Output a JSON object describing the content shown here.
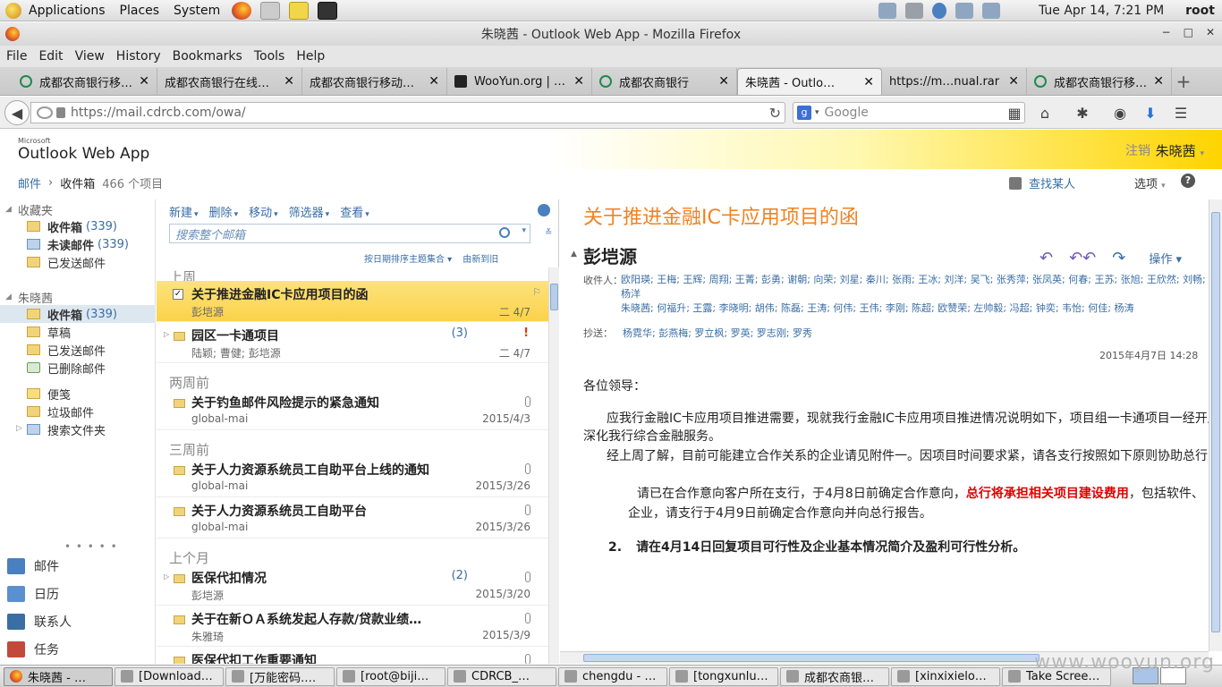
{
  "top_panel": {
    "menus": [
      "Applications",
      "Places",
      "System"
    ],
    "clock": "Tue Apr 14,  7:21 PM",
    "user": "root"
  },
  "window": {
    "title": "朱晓茜 - Outlook Web App - Mozilla Firefox",
    "controls": [
      "−",
      "□",
      "✕"
    ]
  },
  "menubar": [
    "File",
    "Edit",
    "View",
    "History",
    "Bookmarks",
    "Tools",
    "Help"
  ],
  "tabs": [
    {
      "label": "成都农商银行移…",
      "favicon": "cdrcb",
      "active": false
    },
    {
      "label": "成都农商银行在线…",
      "favicon": "none",
      "active": false
    },
    {
      "label": "成都农商银行移动…",
      "favicon": "none",
      "active": false
    },
    {
      "label": "WooYun.org | …",
      "favicon": "wooyun",
      "active": false
    },
    {
      "label": "成都农商银行",
      "favicon": "cdrcb",
      "active": false
    },
    {
      "label": "朱晓茜 - Outlo…",
      "favicon": "owa",
      "active": true
    },
    {
      "label": "https://m…nual.rar",
      "favicon": "none",
      "active": false
    },
    {
      "label": "成都农商银行移…",
      "favicon": "cdrcb",
      "active": false
    }
  ],
  "navbar": {
    "url_host": "https://mail.cdrcb.com",
    "url_path": "/owa/",
    "search_placeholder": "Google"
  },
  "owa": {
    "logo_small": "Microsoft",
    "logo": "Outlook Web App",
    "signout": "注销",
    "user": "朱晓茜",
    "breadcrumb": {
      "mail": "邮件",
      "sep": "›",
      "folder": "收件箱",
      "count": "466 个项目"
    },
    "find_people": "查找某人",
    "options": "选项",
    "help": "?"
  },
  "folders": {
    "favorites_label": "收藏夹",
    "favorites": [
      {
        "name": "收件箱",
        "count": "339",
        "bold": true,
        "icon": "inbox"
      },
      {
        "name": "未读邮件",
        "count": "339",
        "bold": true,
        "icon": "search"
      },
      {
        "name": "已发送邮件",
        "count": "",
        "bold": false,
        "icon": "sent"
      }
    ],
    "mailbox_label": "朱晓茜",
    "mailbox": [
      {
        "name": "收件箱",
        "count": "339",
        "bold": true,
        "selected": true,
        "icon": "inbox"
      },
      {
        "name": "草稿",
        "count": "",
        "bold": false,
        "icon": "drafts"
      },
      {
        "name": "已发送邮件",
        "count": "",
        "bold": false,
        "icon": "sent"
      },
      {
        "name": "已删除邮件",
        "count": "",
        "bold": false,
        "icon": "trash"
      }
    ],
    "other": [
      {
        "name": "便笺",
        "icon": "note"
      },
      {
        "name": "垃圾邮件",
        "icon": "junk"
      },
      {
        "name": "搜索文件夹",
        "icon": "search"
      }
    ],
    "modules": [
      {
        "name": "邮件",
        "icon": "mail"
      },
      {
        "name": "日历",
        "icon": "calendar"
      },
      {
        "name": "联系人",
        "icon": "contacts"
      },
      {
        "name": "任务",
        "icon": "tasks"
      }
    ]
  },
  "list": {
    "toolbar": [
      "新建",
      "删除",
      "移动",
      "筛选器",
      "查看"
    ],
    "search_placeholder": "搜索整个邮箱",
    "sort": [
      "按日期排序主题集合",
      "由新到旧"
    ],
    "groups": [
      "上周",
      "两周前",
      "三周前",
      "上个月"
    ],
    "messages": [
      {
        "subject": "关于推进金融IC卡应用项目的函",
        "sender": "彭垲源",
        "date": "二 4/7",
        "selected": true,
        "count": "",
        "attach": false
      },
      {
        "subject": "园区一卡通项目",
        "sender": "陆颖; 曹健; 彭垲源",
        "date": "二 4/7",
        "selected": false,
        "count": "(3)",
        "attach": false,
        "important": true
      },
      {
        "subject": "关于钓鱼邮件风险提示的紧急通知",
        "sender": "global-mai",
        "date": "2015/4/3",
        "selected": false,
        "count": "",
        "attach": true
      },
      {
        "subject": "关于人力资源系统员工自助平台上线的通知",
        "sender": "global-mai",
        "date": "2015/3/26",
        "selected": false,
        "count": "",
        "attach": true
      },
      {
        "subject": "关于人力资源系统员工自助平台",
        "sender": "global-mai",
        "date": "2015/3/26",
        "selected": false,
        "count": "",
        "attach": true
      },
      {
        "subject": "医保代扣情况",
        "sender": "彭垲源",
        "date": "2015/3/20",
        "selected": false,
        "count": "(2)",
        "attach": true
      },
      {
        "subject": "关于在新ＯＡ系统发起人存款/贷款业绩…",
        "sender": "朱雅琦",
        "date": "2015/3/9",
        "selected": false,
        "count": "",
        "attach": true
      },
      {
        "subject": "医保代扣工作重要通知",
        "sender": "",
        "date": "",
        "selected": false,
        "count": "",
        "attach": true
      }
    ]
  },
  "reading": {
    "subject": "关于推进金融IC卡应用项目的函",
    "from": "彭垲源",
    "actions": {
      "reply": "↶",
      "reply_all": "↶↶",
      "forward": "↷",
      "ops": "操作"
    },
    "to_label": "收件人：",
    "to_line1": "欧阳瑛; 王梅; 王辉; 周翔; 王菁; 彭勇; 谢朝; 向荣; 刘星; 秦川; 张雨; 王冰; 刘洋; 吴飞; 张秀萍; 张凤英; 何春; 王苏; 张旭; 王欣然; 刘畅; 杨洋",
    "to_line2": "朱晓茜; 何福升; 王露; 李晓明; 胡伟; 陈磊; 王涛; 何伟; 王伟; 李刚; 陈超; 欧赞荣; 左帅毅; 冯超; 钟奕; 韦怡; 何佳; 杨涛",
    "cc_label": "抄送：",
    "cc": "杨霓华; 彭燕梅; 罗立枫; 罗英; 罗志刚; 罗秀",
    "date": "2015年4月7日 14:28",
    "greeting": "各位领导：",
    "p1": "应我行金融IC卡应用项目推进需要，现就我行金融IC卡应用项目推进情况说明如下，项目组一卡通项目一经开展，可有效协助支行绑定",
    "p1b": "深化我行综合金融服务。",
    "p2": "经上周了解，目前可能建立合作关系的企业请见附件一。因项目时间要求紧，请各支行按照如下原则协助总行",
    "item1_pre": "请已在合作意向客户所在支行，于4月8日前确定合作意向，",
    "item1_red": "总行将承担相关项目建设费用",
    "item1_post": "，包括软件、",
    "item1b": "企业，请支行于4月9日前确定合作意向并向总行报告。",
    "item2_num": "2.",
    "item2": "请在4月14日回复项目可行性及企业基本情况简介及盈利可行性分析。"
  },
  "taskbar": [
    {
      "label": "朱晓茜 - …",
      "icon": "firefox",
      "active": true
    },
    {
      "label": "[Download…",
      "icon": "folder"
    },
    {
      "label": "[万能密码.…",
      "icon": "editor"
    },
    {
      "label": "[root@biji…",
      "icon": "terminal"
    },
    {
      "label": "CDRCB_…",
      "icon": "file"
    },
    {
      "label": "chengdu - …",
      "icon": "file"
    },
    {
      "label": "[tongxunlu…",
      "icon": "editor"
    },
    {
      "label": "成都农商银…",
      "icon": "folder"
    },
    {
      "label": "[xinxixielo…",
      "icon": "editor"
    },
    {
      "label": "Take Scree…",
      "icon": "camera"
    }
  ],
  "watermark": "www.wooyun.org"
}
